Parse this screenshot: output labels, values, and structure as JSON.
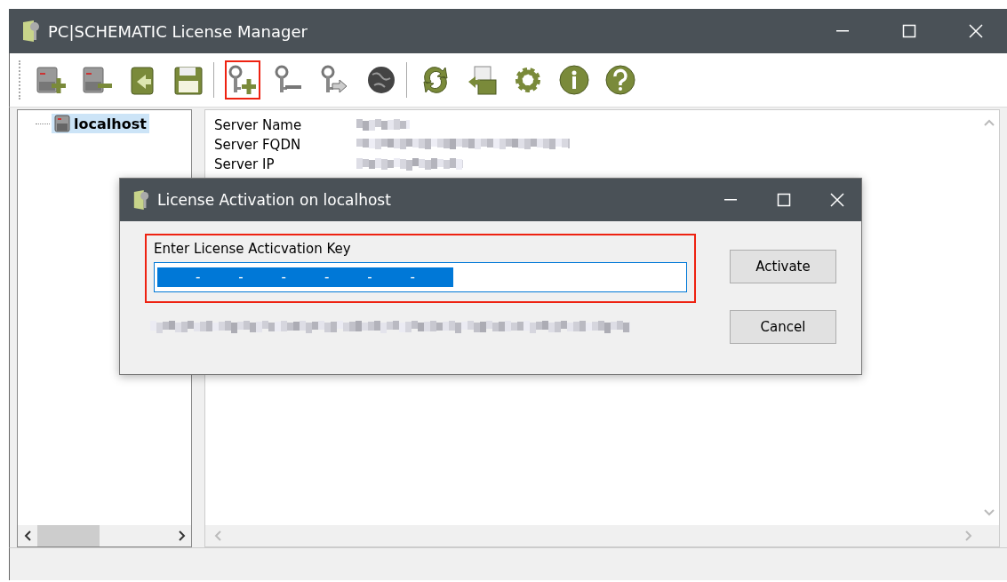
{
  "window": {
    "title": "PC|SCHEMATIC License Manager"
  },
  "toolbar": {
    "groups": [
      [
        {
          "kind": "server-add",
          "selected": false
        },
        {
          "kind": "server-remove",
          "selected": false
        },
        {
          "kind": "import",
          "selected": false
        },
        {
          "kind": "save",
          "selected": false
        }
      ],
      [
        {
          "kind": "key-add",
          "selected": true
        },
        {
          "kind": "key-remove",
          "selected": false
        },
        {
          "kind": "key-export",
          "selected": false
        },
        {
          "kind": "globe",
          "selected": false
        }
      ],
      [
        {
          "kind": "refresh",
          "selected": false
        },
        {
          "kind": "export",
          "selected": false
        },
        {
          "kind": "gear",
          "selected": false
        },
        {
          "kind": "info",
          "selected": false
        },
        {
          "kind": "help",
          "selected": false
        }
      ]
    ]
  },
  "tree": {
    "items": [
      {
        "label": "localhost",
        "selected": true
      }
    ]
  },
  "details": {
    "labels": [
      "Server Name",
      "Server FQDN",
      "Server IP"
    ]
  },
  "dialog": {
    "title": "License Activation on localhost",
    "field_label": "Enter License Acticvation Key",
    "key_value": "         -         -         -         -         -         -         ",
    "value_selected": true,
    "buttons": [
      "Activate",
      "Cancel"
    ]
  }
}
